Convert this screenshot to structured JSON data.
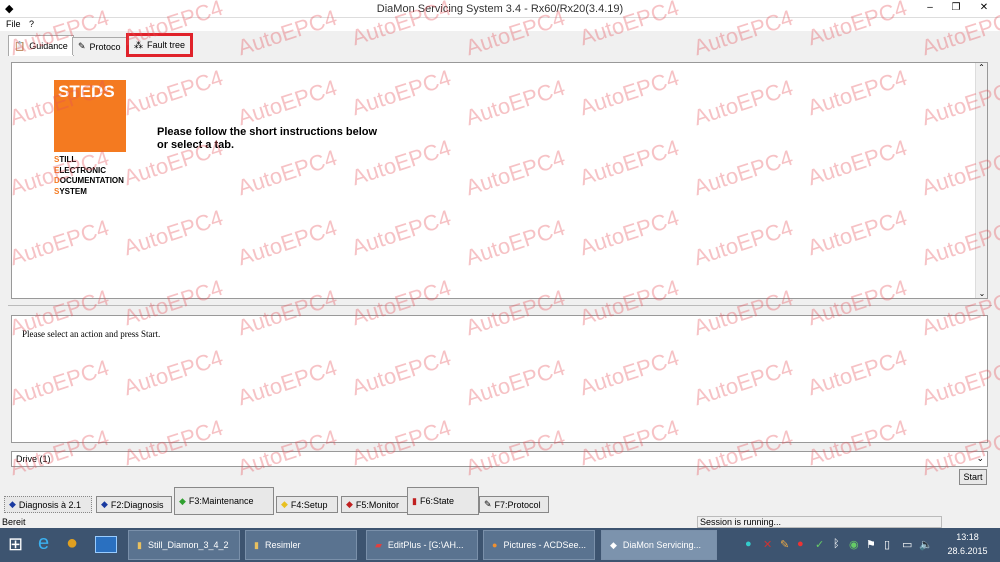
{
  "window": {
    "title": "DiaMon Servicing System 3.4 - Rx60/Rx20(3.4.19)",
    "minimize": "–",
    "maximize": "❐",
    "close": "✕"
  },
  "menu": [
    "File",
    "?"
  ],
  "tabs": [
    {
      "label": "Guidance",
      "icon": "guidance-icon"
    },
    {
      "label": "Protoco",
      "icon": "protocol-icon"
    },
    {
      "label": "Fault tree",
      "icon": "fault-tree-icon"
    }
  ],
  "logo": {
    "brand": "STEDS",
    "lines": [
      {
        "first": "S",
        "rest": "TILL"
      },
      {
        "first": "E",
        "rest": "LECTRONIC"
      },
      {
        "first": "D",
        "rest": "OCUMENTATION"
      },
      {
        "first": "S",
        "rest": "YSTEM"
      }
    ]
  },
  "instructions": {
    "line1": "Please follow the short instructions below",
    "line2": "or select a tab."
  },
  "hint": "Please select an action and press Start.",
  "dropdown": {
    "value": "Drive (1)"
  },
  "start_label": "Start",
  "function_buttons": [
    {
      "label": "Diagnosis à 2.1",
      "color": "#1a3aa0"
    },
    {
      "label": "F2:Diagnosis",
      "color": "#1a3aa0"
    },
    {
      "label": "F3:Maintenance",
      "color": "#2fa02f"
    },
    {
      "label": "F4:Setup",
      "color": "#e8c020"
    },
    {
      "label": "F5:Monitor",
      "color": "#c02020"
    },
    {
      "label": "F6:State",
      "color": "#c02020"
    },
    {
      "label": "F7:Protocol",
      "color": "#888888"
    }
  ],
  "status": {
    "left": "Bereit",
    "session": "Session is running..."
  },
  "taskbar": {
    "items": [
      "Still_Diamon_3_4_2",
      "Resimler",
      "EditPlus - [G:\\AH...",
      "Pictures - ACDSee...",
      "DiaMon Servicing..."
    ],
    "time": "13:18",
    "date": "28.6.2015"
  },
  "watermark": "AutoEPC4"
}
